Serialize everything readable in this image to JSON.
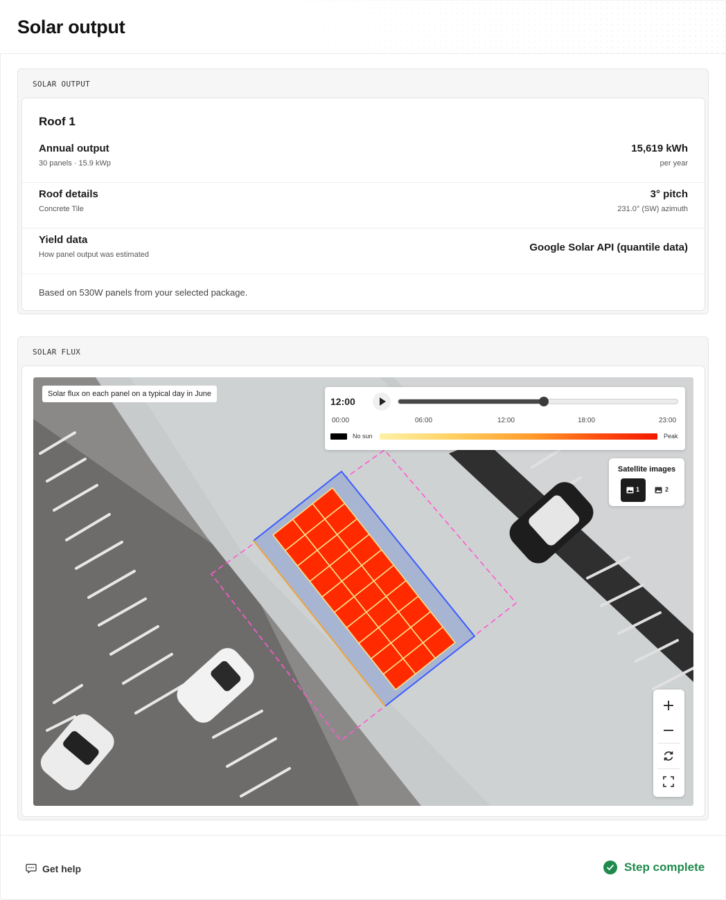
{
  "page": {
    "title": "Solar output"
  },
  "solar_output": {
    "section_label": "SOLAR OUTPUT",
    "roof_title": "Roof 1",
    "rows": [
      {
        "title": "Annual output",
        "subtitle": "30 panels · 15.9 kWp",
        "value": "15,619 kWh",
        "value_sub": "per year"
      },
      {
        "title": "Roof details",
        "subtitle": "Concrete Tile",
        "value": "3° pitch",
        "value_sub": "231.0° (SW) azimuth"
      },
      {
        "title": "Yield data",
        "subtitle": "How panel output was estimated",
        "value": "Google Solar API (quantile data)",
        "value_sub": ""
      }
    ],
    "note": "Based on 530W panels from your selected package."
  },
  "solar_flux": {
    "section_label": "SOLAR FLUX",
    "caption": "Solar flux on each panel on a typical day in June",
    "time": {
      "current": "12:00",
      "ticks": [
        "00:00",
        "06:00",
        "12:00",
        "18:00",
        "23:00"
      ],
      "progress": 0.52
    },
    "legend": {
      "low_label": "No sun",
      "high_label": "Peak",
      "low_color": "#000000",
      "gradient": [
        "#fdf1a8",
        "#ffd266",
        "#ff9a2a",
        "#ff4a0e",
        "#f21a00"
      ]
    },
    "satellite": {
      "title": "Satellite images",
      "options": [
        {
          "label": "1",
          "icon": "image-icon",
          "selected": true
        },
        {
          "label": "2",
          "icon": "image-icon",
          "selected": false
        }
      ]
    },
    "map_controls": [
      "zoom-in-icon",
      "zoom-out-icon",
      "rotate-reset-icon",
      "fullscreen-icon"
    ],
    "panel_color": "#ff2a00",
    "roof_outline_color": "#3b5bff",
    "setback_outline_color": "#ff59d0",
    "ridge_color": "#f0a33a"
  },
  "footer": {
    "help_label": "Get help",
    "status_label": "Step complete",
    "status_color": "#1f8a4c"
  }
}
